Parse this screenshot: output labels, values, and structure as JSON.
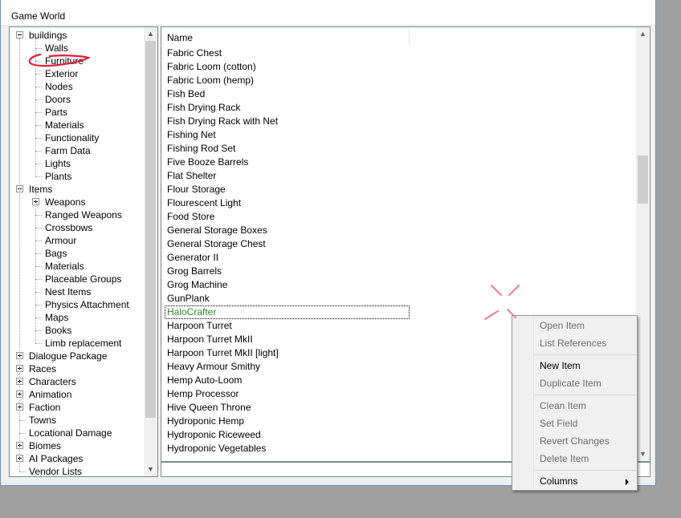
{
  "window": {
    "title": "Game World"
  },
  "tree": {
    "items": [
      {
        "label": "buildings",
        "level": 0,
        "expander": "minus"
      },
      {
        "label": "Walls",
        "level": 1
      },
      {
        "label": "Furniture",
        "level": 1
      },
      {
        "label": "Exterior",
        "level": 1
      },
      {
        "label": "Nodes",
        "level": 1
      },
      {
        "label": "Doors",
        "level": 1
      },
      {
        "label": "Parts",
        "level": 1
      },
      {
        "label": "Materials",
        "level": 1
      },
      {
        "label": "Functionality",
        "level": 1
      },
      {
        "label": "Farm Data",
        "level": 1
      },
      {
        "label": "Lights",
        "level": 1
      },
      {
        "label": "Plants",
        "level": 1
      },
      {
        "label": "Items",
        "level": 0,
        "expander": "minus"
      },
      {
        "label": "Weapons",
        "level": 1,
        "expander": "plus"
      },
      {
        "label": "Ranged Weapons",
        "level": 1
      },
      {
        "label": "Crossbows",
        "level": 1
      },
      {
        "label": "Armour",
        "level": 1
      },
      {
        "label": "Bags",
        "level": 1
      },
      {
        "label": "Materials",
        "level": 1
      },
      {
        "label": "Placeable Groups",
        "level": 1
      },
      {
        "label": "Nest Items",
        "level": 1
      },
      {
        "label": "Physics Attachment",
        "level": 1
      },
      {
        "label": "Maps",
        "level": 1
      },
      {
        "label": "Books",
        "level": 1
      },
      {
        "label": "Limb replacement",
        "level": 1
      },
      {
        "label": "Dialogue Package",
        "level": 0,
        "expander": "plus"
      },
      {
        "label": "Races",
        "level": 0,
        "expander": "plus"
      },
      {
        "label": "Characters",
        "level": 0,
        "expander": "plus"
      },
      {
        "label": "Animation",
        "level": 0,
        "expander": "plus"
      },
      {
        "label": "Faction",
        "level": 0,
        "expander": "plus"
      },
      {
        "label": "Towns",
        "level": 0
      },
      {
        "label": "Locational Damage",
        "level": 0
      },
      {
        "label": "Biomes",
        "level": 0,
        "expander": "plus"
      },
      {
        "label": "AI Packages",
        "level": 0,
        "expander": "plus"
      },
      {
        "label": "Vendor Lists",
        "level": 0
      }
    ]
  },
  "list": {
    "column_name": "Name",
    "rows": [
      "Fabric Chest",
      "Fabric Loom (cotton)",
      "Fabric Loom (hemp)",
      "Fish Bed",
      "Fish Drying Rack",
      "Fish Drying Rack with Net",
      "Fishing Net",
      "Fishing Rod Set",
      "Five Booze Barrels",
      "Flat Shelter",
      "Flour Storage",
      "Flourescent Light",
      "Food Store",
      "General Storage Boxes",
      "General Storage Chest",
      "Generator II",
      "Grog Barrels",
      "Grog Machine",
      "GunPlank",
      "HaloCrafter",
      "Harpoon Turret",
      "Harpoon Turret MkII",
      "Harpoon Turret MkII [light]",
      "Heavy Armour Smithy",
      "Hemp Auto-Loom",
      "Hemp Processor",
      "Hive Queen Throne",
      "Hydroponic Hemp",
      "Hydroponic Riceweed",
      "Hydroponic Vegetables"
    ],
    "selected_index": 19
  },
  "context_menu": {
    "items": [
      {
        "label": "Open Item",
        "enabled": false
      },
      {
        "label": "List References",
        "enabled": false
      },
      {
        "label": "New Item",
        "enabled": true
      },
      {
        "label": "Duplicate Item",
        "enabled": false
      },
      {
        "label": "Clean Item",
        "enabled": false
      },
      {
        "label": "Set Field",
        "enabled": false
      },
      {
        "label": "Revert Changes",
        "enabled": false
      },
      {
        "label": "Delete Item",
        "enabled": false
      },
      {
        "label": "Columns",
        "enabled": true,
        "submenu": true
      }
    ]
  },
  "colors": {
    "selected_text": "#2d8b2d",
    "annotation_red": "#e0203a"
  }
}
